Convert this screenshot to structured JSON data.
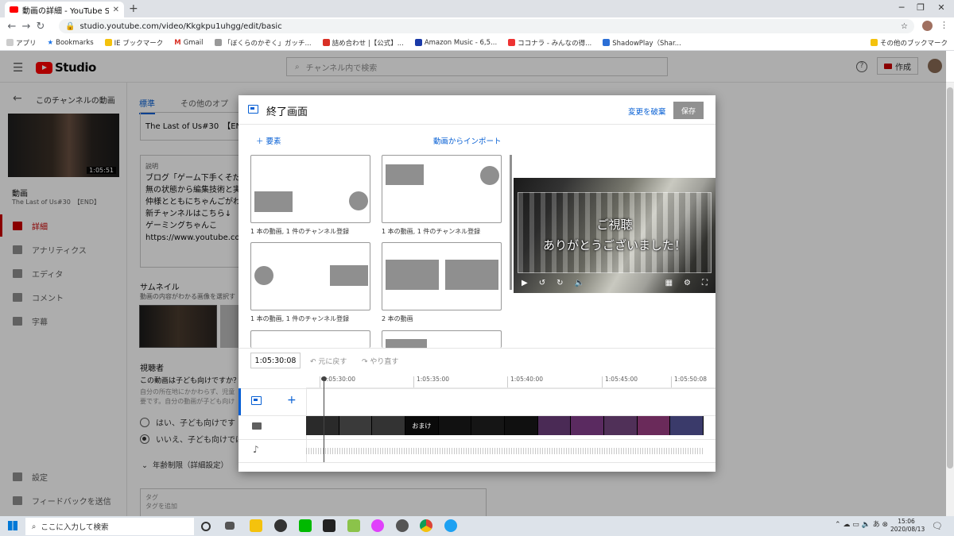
{
  "browser": {
    "tab_title": "動画の詳細 - YouTube Studio",
    "url": "studio.youtube.com/video/Kkgkpu1uhgg/edit/basic",
    "bookmarks": [
      "アプリ",
      "Bookmarks",
      "IE ブックマーク",
      "Gmail",
      "「ぼくらのかぞく」ガッチ...",
      "詰め合わせ |【公式】...",
      "Amazon Music - 6,5...",
      "ココナラ - みんなの得...",
      "ShadowPlay（Shar...",
      "その他のブックマーク"
    ]
  },
  "studio": {
    "logo_text": "Studio",
    "search_placeholder": "チャンネル内で検索",
    "create_label": "作成",
    "help_glyph": "?"
  },
  "sidebar": {
    "back_label": "このチャンネルの動画",
    "thumb_duration": "1:05:51",
    "video_heading": "動画",
    "video_title": "The Last of Us#30　【END】",
    "items": [
      {
        "label": "詳細",
        "icon": "pencil-icon",
        "active": true
      },
      {
        "label": "アナリティクス",
        "icon": "analytics-icon",
        "active": false
      },
      {
        "label": "エディタ",
        "icon": "editor-icon",
        "active": false
      },
      {
        "label": "コメント",
        "icon": "comment-icon",
        "active": false
      },
      {
        "label": "字幕",
        "icon": "subtitles-icon",
        "active": false
      }
    ],
    "bottom_items": [
      {
        "label": "設定",
        "icon": "gear-icon"
      },
      {
        "label": "フィードバックを送信",
        "icon": "feedback-icon"
      }
    ]
  },
  "details": {
    "tabs": [
      "標準",
      "その他のオプ"
    ],
    "title_value": "The Last of Us#30　【END】",
    "desc_label": "説明",
    "desc_lines": [
      "ブログ「ゲーム下手くそだ",
      "無の状態から編集技術と実",
      "仲様とともにちゃんごがわ",
      "新チャンネルはこちら↓",
      "ゲーミングちゃんこ",
      "https://www.youtube.com/c"
    ],
    "thumb_label": "サムネイル",
    "thumb_desc": "動画の内容がわかる画像を選択す",
    "audience_label": "視聴者",
    "audience_q": "この動画は子ども向けですか？",
    "audience_desc": [
      "自分の所在地にかかわらず、児童",
      "要です。自分の動画が子ども向け"
    ],
    "radio_yes": "はい、子ども向けです",
    "radio_no": "いいえ、子ども向けでは",
    "age_row": "年齢制限（詳細設定）",
    "tag_label": "タグ",
    "tag_placeholder": "タグを追加"
  },
  "modal": {
    "title": "終了画面",
    "discard": "変更を破棄",
    "save": "保存",
    "add_element": "要素",
    "import": "動画からインポート",
    "templates": [
      {
        "caption": "1 本の動画, 1 件のチャンネル登録"
      },
      {
        "caption": "1 本の動画, 1 件のチャンネル登録"
      },
      {
        "caption": "1 本の動画, 1 件のチャンネル登録"
      },
      {
        "caption": "2 本の動画"
      }
    ],
    "preview_line1": "ご視聴",
    "preview_line2": "ありがとうございました！",
    "timecode": "1:05:30:08",
    "undo": "元に戻す",
    "redo": "やり直す",
    "ruler_ticks": [
      "1:05:30:00",
      "1:05:35:00",
      "1:05:40:00",
      "1:05:45:00",
      "1:05:50:08"
    ],
    "filmstrip_label": "おまけ"
  },
  "taskbar": {
    "search_placeholder": "ここに入力して検索",
    "time": "15:06",
    "date": "2020/08/13"
  },
  "colors": {
    "accent": "#065fd4",
    "brand_red": "#ff0000",
    "active_red": "#cc0000"
  }
}
